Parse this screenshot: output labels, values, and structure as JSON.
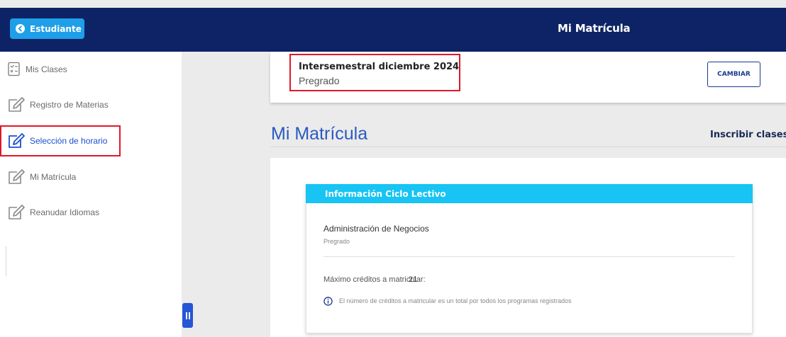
{
  "header": {
    "student_button": "Estudiante",
    "title": "Mi Matrícula"
  },
  "sidebar": {
    "items": [
      {
        "label": "Mis Clases",
        "icon": "checklist-icon"
      },
      {
        "label": "Registro de Materias",
        "icon": "edit-icon"
      },
      {
        "label": "Selección de horario",
        "icon": "edit-icon",
        "active": true
      },
      {
        "label": "Mi Matrícula",
        "icon": "edit-icon"
      },
      {
        "label": "Reanudar Idiomas",
        "icon": "edit-icon"
      }
    ]
  },
  "period": {
    "name": "Intersemestral diciembre 2024",
    "level": "Pregrado",
    "change_label": "CAMBIAR"
  },
  "main": {
    "heading": "Mi Matrícula",
    "enroll_link": "Inscribir clases"
  },
  "info_card": {
    "title": "Información Ciclo Lectivo",
    "program": "Administración de Negocios",
    "program_level": "Pregrado",
    "credits_label": "Máximo créditos a matricular:",
    "credits_value": "21",
    "note": "El número de créditos a matricular es un total por todos los programas registrados"
  },
  "colors": {
    "topbar": "#0d2365",
    "accent": "#1e9fe8",
    "card_header": "#17c4f3",
    "highlight": "#e0182a",
    "link_active": "#1a4fd0"
  }
}
